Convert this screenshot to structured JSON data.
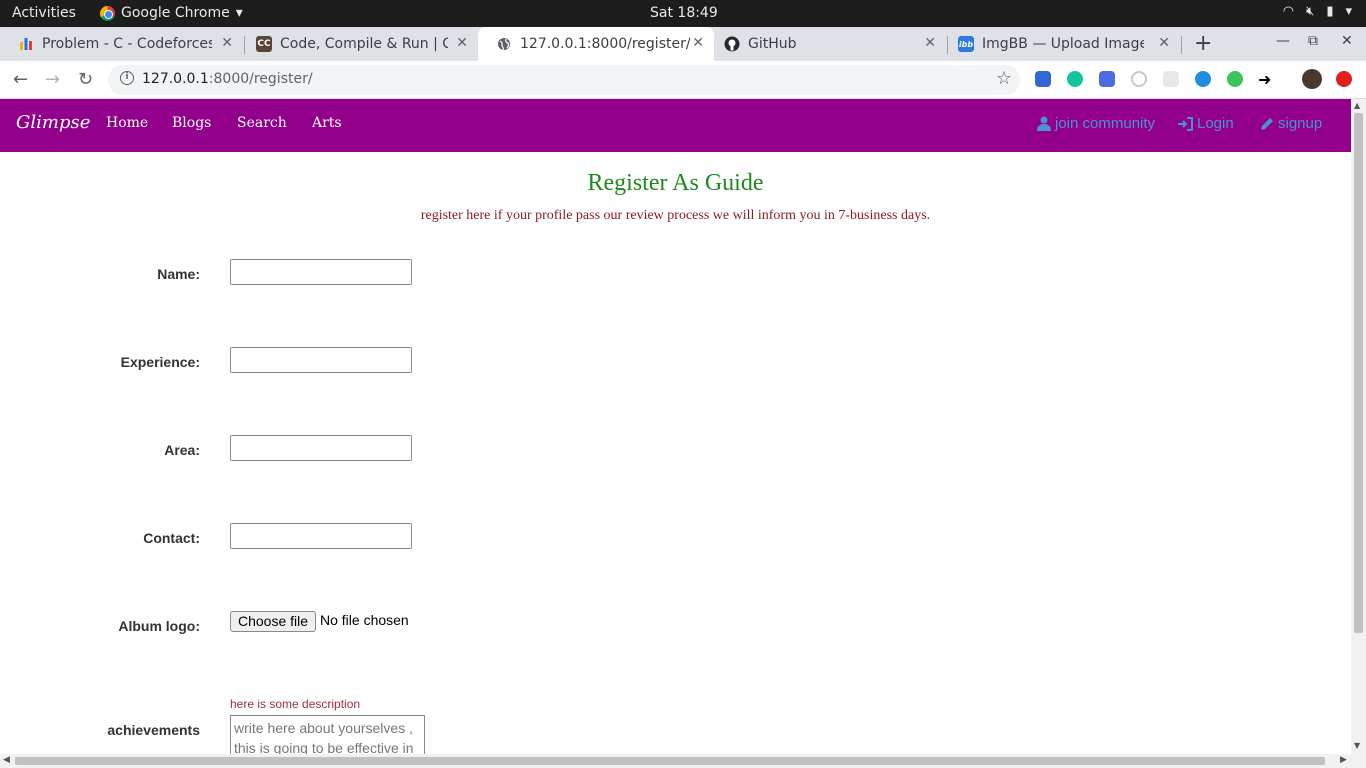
{
  "system": {
    "activities": "Activities",
    "app_name": "Google Chrome",
    "clock": "Sat 18:49"
  },
  "tabs": [
    {
      "title": "Problem - C - Codeforces",
      "icon": "codeforces-icon"
    },
    {
      "title": "Code, Compile & Run | Co",
      "icon": "codechef-icon",
      "icon_text": "CC"
    },
    {
      "title": "127.0.0.1:8000/register/",
      "icon": "globe-icon",
      "active": true
    },
    {
      "title": "GitHub",
      "icon": "github-icon"
    },
    {
      "title": "ImgBB — Upload Image",
      "icon": "imgbb-icon",
      "icon_text": "ibb"
    }
  ],
  "address": {
    "host": "127.0.0.1",
    "rest": ":8000/register/"
  },
  "site": {
    "brand": "Glimpse",
    "nav": [
      "Home",
      "Blogs",
      "Search",
      "Arts"
    ],
    "right_links": {
      "join": "join community",
      "login": "Login",
      "signup": "signup"
    }
  },
  "page": {
    "title": "Register As Guide",
    "subtitle": "register here if your profile pass our review process we will inform you in 7-business days."
  },
  "form": {
    "name_label": "Name:",
    "experience_label": "Experience:",
    "area_label": "Area:",
    "contact_label": "Contact:",
    "album_logo_label": "Album logo:",
    "choose_file": "Choose file",
    "no_file": "No file chosen",
    "achievements_label": "achievements",
    "achievements_help": "here is some description",
    "achievements_placeholder": "write here about yourselves , this is going to be effective in"
  },
  "colors": {
    "nav_bg": "#92008b",
    "title_green": "#1b8c1b",
    "subtitle_red": "#8b1a1a",
    "link_blue": "#4a90d9"
  }
}
